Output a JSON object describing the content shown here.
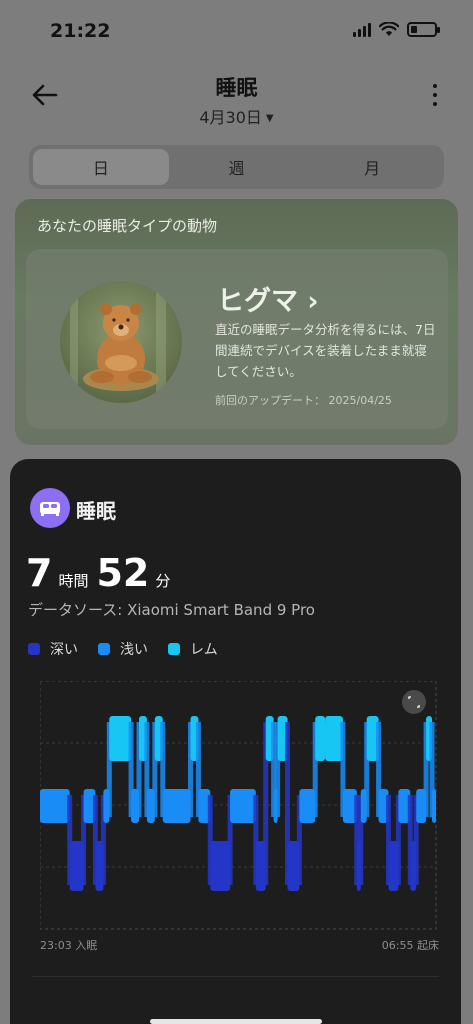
{
  "status_bar": {
    "time": "21:22"
  },
  "header": {
    "title": "睡眠",
    "date": "4月30日"
  },
  "tabs": [
    {
      "label": "日",
      "active": true
    },
    {
      "label": "週",
      "active": false
    },
    {
      "label": "月",
      "active": false
    }
  ],
  "animal_card": {
    "heading": "あなたの睡眠タイプの動物",
    "animal_name": "ヒグマ ›",
    "description": "直近の睡眠データ分析を得るには、7日間連続でデバイスを装着したまま就寝してください。",
    "last_updated": "前回のアップデート： 2025/04/25"
  },
  "sleep_card": {
    "title": "睡眠",
    "hours": "7",
    "hours_unit": "時間",
    "minutes": "52",
    "minutes_unit": "分",
    "source": "データソース: Xiaomi Smart Band 9 Pro",
    "legend": [
      {
        "label": "深い",
        "color": "#2436c8"
      },
      {
        "label": "浅い",
        "color": "#1a8cf5"
      },
      {
        "label": "レム",
        "color": "#17c6f2"
      }
    ],
    "sleep_start": "23:03 入眠",
    "wake_time": "06:55 起床"
  },
  "chart_data": {
    "type": "area",
    "title": "",
    "x_start": "23:03",
    "x_end": "06:55",
    "stage_levels": [
      "深い",
      "浅い",
      "レム"
    ],
    "segments": [
      {
        "from": 0.0,
        "to": 0.075,
        "stage": "浅い"
      },
      {
        "from": 0.075,
        "to": 0.11,
        "stage": "深い"
      },
      {
        "from": 0.11,
        "to": 0.14,
        "stage": "浅い"
      },
      {
        "from": 0.14,
        "to": 0.16,
        "stage": "深い"
      },
      {
        "from": 0.16,
        "to": 0.175,
        "stage": "浅い"
      },
      {
        "from": 0.175,
        "to": 0.23,
        "stage": "レム"
      },
      {
        "from": 0.23,
        "to": 0.25,
        "stage": "浅い"
      },
      {
        "from": 0.25,
        "to": 0.27,
        "stage": "レム"
      },
      {
        "from": 0.27,
        "to": 0.29,
        "stage": "浅い"
      },
      {
        "from": 0.29,
        "to": 0.31,
        "stage": "レム"
      },
      {
        "from": 0.31,
        "to": 0.38,
        "stage": "浅い"
      },
      {
        "from": 0.38,
        "to": 0.4,
        "stage": "レム"
      },
      {
        "from": 0.4,
        "to": 0.43,
        "stage": "浅い"
      },
      {
        "from": 0.43,
        "to": 0.48,
        "stage": "深い"
      },
      {
        "from": 0.48,
        "to": 0.545,
        "stage": "浅い"
      },
      {
        "from": 0.545,
        "to": 0.57,
        "stage": "深い"
      },
      {
        "from": 0.57,
        "to": 0.59,
        "stage": "レム"
      },
      {
        "from": 0.59,
        "to": 0.6,
        "stage": "浅い"
      },
      {
        "from": 0.6,
        "to": 0.625,
        "stage": "レム"
      },
      {
        "from": 0.625,
        "to": 0.655,
        "stage": "深い"
      },
      {
        "from": 0.655,
        "to": 0.695,
        "stage": "浅い"
      },
      {
        "from": 0.695,
        "to": 0.72,
        "stage": "レム"
      },
      {
        "from": 0.72,
        "to": 0.765,
        "stage": "レム"
      },
      {
        "from": 0.765,
        "to": 0.8,
        "stage": "浅い"
      },
      {
        "from": 0.8,
        "to": 0.81,
        "stage": "深い"
      },
      {
        "from": 0.81,
        "to": 0.825,
        "stage": "浅い"
      },
      {
        "from": 0.825,
        "to": 0.855,
        "stage": "レム"
      },
      {
        "from": 0.855,
        "to": 0.88,
        "stage": "浅い"
      },
      {
        "from": 0.88,
        "to": 0.905,
        "stage": "深い"
      },
      {
        "from": 0.905,
        "to": 0.935,
        "stage": "浅い"
      },
      {
        "from": 0.935,
        "to": 0.95,
        "stage": "深い"
      },
      {
        "from": 0.95,
        "to": 0.975,
        "stage": "浅い"
      },
      {
        "from": 0.975,
        "to": 0.99,
        "stage": "レム"
      },
      {
        "from": 0.99,
        "to": 1.0,
        "stage": "浅い"
      }
    ]
  }
}
